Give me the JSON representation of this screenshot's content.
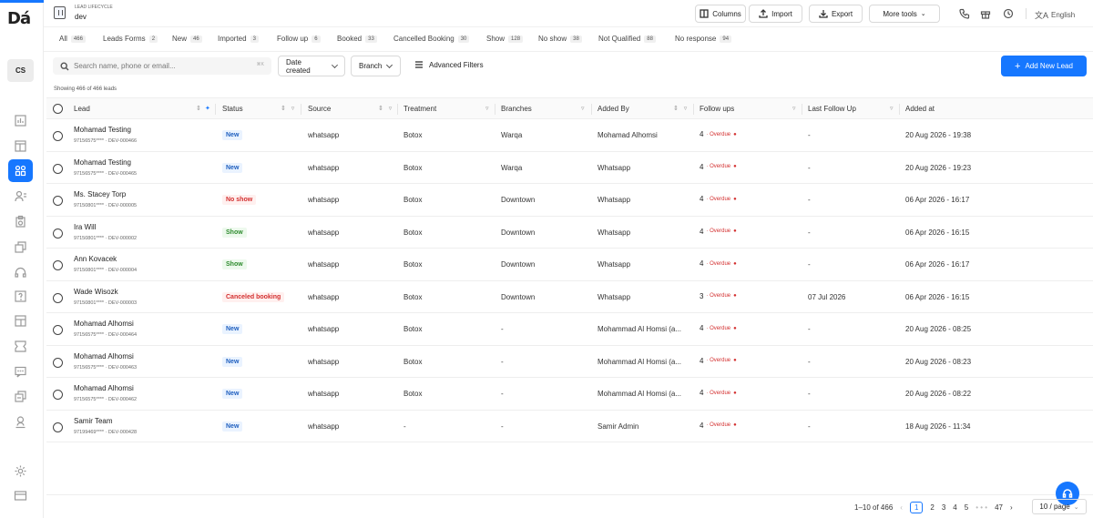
{
  "sidebar": {
    "logo": "Dá",
    "avatar": "CS",
    "nav_icons": [
      "bar-chart-icon",
      "layout-icon",
      "grid-icon",
      "users-icon",
      "clipboard-icon",
      "copy-icon",
      "headset-icon",
      "question-icon",
      "layout-alt-icon",
      "tray-icon",
      "chat-icon",
      "copy-alt-icon",
      "person-icon",
      "settings-icon",
      "card-icon"
    ],
    "active_index": 2
  },
  "header": {
    "section_label": "LEAD LIFECYCLE",
    "section_value": "dev",
    "columns_label": "Columns",
    "import_label": "Import",
    "export_label": "Export",
    "more_tools_label": "More tools",
    "language": "English"
  },
  "tabs": [
    {
      "label": "All",
      "count": "466"
    },
    {
      "label": "Leads Forms",
      "count": "2"
    },
    {
      "label": "New",
      "count": "46"
    },
    {
      "label": "Imported",
      "count": "3"
    },
    {
      "label": "Follow up",
      "count": "6"
    },
    {
      "label": "Booked",
      "count": "33"
    },
    {
      "label": "Cancelled Booking",
      "count": "30"
    },
    {
      "label": "Show",
      "count": "128"
    },
    {
      "label": "No show",
      "count": "38"
    },
    {
      "label": "Not Qualified",
      "count": "88"
    },
    {
      "label": "No response",
      "count": "94"
    }
  ],
  "toolbar": {
    "search_placeholder": "Search name, phone or email...",
    "search_shortcut": "⌘K",
    "date_filter": "Date created",
    "branch_filter": "Branch",
    "advanced_filters": "Advanced Filters",
    "add_lead": "Add New Lead"
  },
  "showing": "Showing 466 of 466 leads",
  "columns": {
    "lead": "Lead",
    "status": "Status",
    "source": "Source",
    "treatment": "Treatment",
    "branches": "Branches",
    "added_by": "Added By",
    "follow_ups": "Follow ups",
    "last_follow_up": "Last Follow Up",
    "added_at": "Added at"
  },
  "rows": [
    {
      "name": "Mohamad Testing",
      "sub": "97156575**** · DEV-000466",
      "status": "New",
      "status_type": "new",
      "source": "whatsapp",
      "treatment": "Botox",
      "branch": "Warqa",
      "added_by": "Mohamad Alhomsi",
      "follow_ups": "4",
      "overdue": "Overdue",
      "last_follow_up": "-",
      "added_at": "20 Aug 2026 - 19:38"
    },
    {
      "name": "Mohamad Testing",
      "sub": "97156575**** · DEV-000465",
      "status": "New",
      "status_type": "new",
      "source": "whatsapp",
      "treatment": "Botox",
      "branch": "Warqa",
      "added_by": "Whatsapp",
      "follow_ups": "4",
      "overdue": "Overdue",
      "last_follow_up": "-",
      "added_at": "20 Aug 2026 - 19:23"
    },
    {
      "name": "Ms. Stacey Torp",
      "sub": "97150801**** · DEV-000005",
      "status": "No show",
      "status_type": "noshow",
      "source": "whatsapp",
      "treatment": "Botox",
      "branch": "Downtown",
      "added_by": "Whatsapp",
      "follow_ups": "4",
      "overdue": "Overdue",
      "last_follow_up": "-",
      "added_at": "06 Apr 2026 - 16:17"
    },
    {
      "name": "Ira Will",
      "sub": "97150801**** · DEV-000002",
      "status": "Show",
      "status_type": "show",
      "source": "whatsapp",
      "treatment": "Botox",
      "branch": "Downtown",
      "added_by": "Whatsapp",
      "follow_ups": "4",
      "overdue": "Overdue",
      "last_follow_up": "-",
      "added_at": "06 Apr 2026 - 16:15"
    },
    {
      "name": "Ann Kovacek",
      "sub": "97150801**** · DEV-000004",
      "status": "Show",
      "status_type": "show",
      "source": "whatsapp",
      "treatment": "Botox",
      "branch": "Downtown",
      "added_by": "Whatsapp",
      "follow_ups": "4",
      "overdue": "Overdue",
      "last_follow_up": "-",
      "added_at": "06 Apr 2026 - 16:17"
    },
    {
      "name": "Wade Wisozk",
      "sub": "97150801**** · DEV-000003",
      "status": "Canceled booking",
      "status_type": "cancel",
      "source": "whatsapp",
      "treatment": "Botox",
      "branch": "Downtown",
      "added_by": "Whatsapp",
      "follow_ups": "3",
      "overdue": "Overdue",
      "last_follow_up": "07 Jul 2026",
      "added_at": "06 Apr 2026 - 16:15"
    },
    {
      "name": "Mohamad Alhomsi",
      "sub": "97156575**** · DEV-000464",
      "status": "New",
      "status_type": "new",
      "source": "whatsapp",
      "treatment": "Botox",
      "branch": "-",
      "added_by": "Mohammad Al Homsi (a...",
      "follow_ups": "4",
      "overdue": "Overdue",
      "last_follow_up": "-",
      "added_at": "20 Aug 2026 - 08:25"
    },
    {
      "name": "Mohamad Alhomsi",
      "sub": "97156575**** · DEV-000463",
      "status": "New",
      "status_type": "new",
      "source": "whatsapp",
      "treatment": "Botox",
      "branch": "-",
      "added_by": "Mohammad Al Homsi (a...",
      "follow_ups": "4",
      "overdue": "Overdue",
      "last_follow_up": "-",
      "added_at": "20 Aug 2026 - 08:23"
    },
    {
      "name": "Mohamad Alhomsi",
      "sub": "97156575**** · DEV-000462",
      "status": "New",
      "status_type": "new",
      "source": "whatsapp",
      "treatment": "Botox",
      "branch": "-",
      "added_by": "Mohammad Al Homsi (a...",
      "follow_ups": "4",
      "overdue": "Overdue",
      "last_follow_up": "-",
      "added_at": "20 Aug 2026 - 08:22"
    },
    {
      "name": "Samir Team",
      "sub": "97199469**** · DEV-000428",
      "status": "New",
      "status_type": "new",
      "source": "whatsapp",
      "treatment": "-",
      "branch": "-",
      "added_by": "Samir Admin",
      "follow_ups": "4",
      "overdue": "Overdue",
      "last_follow_up": "-",
      "added_at": "18 Aug 2026 - 11:34"
    }
  ],
  "pagination": {
    "range": "1–10 of 466",
    "pages": [
      "1",
      "2",
      "3",
      "4",
      "5"
    ],
    "ellipsis": "• • •",
    "last": "47",
    "page_size": "10 / page"
  }
}
